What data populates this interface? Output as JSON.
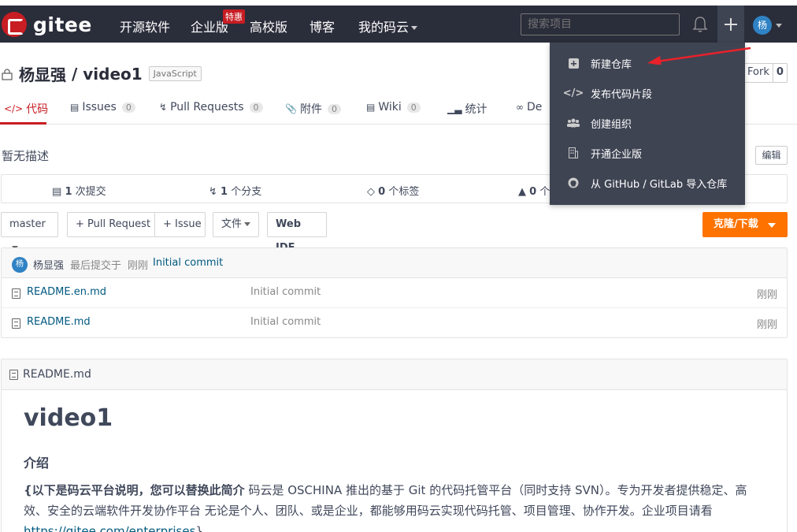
{
  "nav": {
    "logo": "gitee",
    "items": [
      "开源软件",
      "企业版",
      "高校版",
      "博客",
      "我的码云"
    ],
    "badge": "特惠",
    "search_placeholder": "搜索项目",
    "avatar": "杨"
  },
  "repo": {
    "owner": "杨显强",
    "separator": " / ",
    "name": "video1",
    "language": "JavaScript",
    "fork_label": "Fork",
    "fork_count": "0"
  },
  "tabs": [
    {
      "label": "代码",
      "icon": "code-icon"
    },
    {
      "label": "Issues",
      "count": "0",
      "icon": "issue-icon"
    },
    {
      "label": "Pull Requests",
      "count": "0",
      "icon": "pull-request-icon"
    },
    {
      "label": "附件",
      "count": "0",
      "icon": "paperclip-icon"
    },
    {
      "label": "Wiki",
      "count": "0",
      "icon": "wiki-icon"
    },
    {
      "label": "统计",
      "icon": "stats-icon"
    },
    {
      "label": "De",
      "icon": "devops-icon"
    }
  ],
  "description": "暂无描述",
  "edit_label": "编辑",
  "stats": {
    "commits_num": "1",
    "commits_label": "次提交",
    "branches_num": "1",
    "branches_label": "个分支",
    "tags_num": "0",
    "tags_label": "个标签",
    "releases_num": "0",
    "releases_label": "个"
  },
  "toolbar": {
    "branch": "master",
    "pull_request": "+ Pull Request",
    "issue": "+ Issue",
    "file": "文件",
    "web_ide": "Web IDE",
    "clone": "克隆/下载"
  },
  "commit": {
    "author": "杨显强",
    "meta": "最后提交于",
    "time": "刚刚",
    "message": "Initial commit",
    "avatar": "杨"
  },
  "files": [
    {
      "name": "README.en.md",
      "message": "Initial commit",
      "time": "刚刚"
    },
    {
      "name": "README.md",
      "message": "Initial commit",
      "time": "刚刚"
    }
  ],
  "readme": {
    "filename": "README.md",
    "h1": "video1",
    "h2": "介绍",
    "lead_bold": "{以下是码云平台说明，您可以替换此简介",
    "body": " 码云是 OSCHINA 推出的基于 Git 的代码托管平台（同时支持 SVN）。专为开发者提供稳定、高效、安全的云端软件开发协作平台 无论是个人、团队、或是企业，都能够用码云实现代码托管、项目管理、协作开发。企业项目请看 ",
    "link": "https://gitee.com/enterprises",
    "tail": "}"
  },
  "dropdown": [
    {
      "label": "新建仓库",
      "icon": "plus-square-icon"
    },
    {
      "label": "发布代码片段",
      "icon": "code-snippet-icon"
    },
    {
      "label": "创建组织",
      "icon": "group-icon"
    },
    {
      "label": "开通企业版",
      "icon": "building-icon"
    },
    {
      "label": "从 GitHub / GitLab 导入仓库",
      "icon": "github-icon"
    }
  ],
  "colors": {
    "topbar": "#2a2d3a",
    "brand_red": "#c71d23",
    "clone_orange": "#fe7300",
    "dropdown_bg": "#3f4453",
    "annotation_arrow": "#e8212a"
  }
}
